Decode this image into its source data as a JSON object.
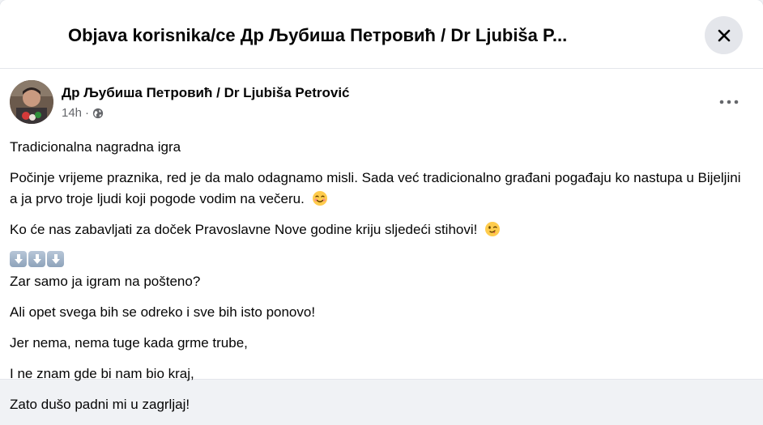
{
  "dialog": {
    "title": "Objava korisnika/ce Др Љубиша Петровић / Dr Ljubiša P...",
    "close_icon": "close-icon"
  },
  "post": {
    "author": "Др Љубиша Петровић / Dr Ljubiša Petrović",
    "time": "14h",
    "separator": "·",
    "audience_icon": "globe-icon",
    "more_icon": "more-horizontal-icon",
    "paragraphs": {
      "p1": "Tradicionalna nagradna igra",
      "p2": "Počinje vrijeme praznika, red je da malo odagnamo misli. Sada već tradicionalno građani pogađaju ko nastupa u Bijeljini a ja prvo troje ljudi koji pogode vodim na večeru.",
      "p3": "Ko će nas zabavljati za doček Pravoslavne Nove godine kriju sljedeći stihovi!"
    },
    "emojis": {
      "p2": "smiling-face-emoji",
      "p3": "winking-face-emoji",
      "arrows": "down-arrow-emoji"
    },
    "poem": [
      "Zar samo ja igram na pošteno?",
      "Ali opet svega bih se odreko i sve bih isto ponovo!",
      "Jer nema, nema tuge kada grme trube,",
      "I ne znam gde bi nam bio kraj,",
      "Zato dušo padni mi u zagrljaj!"
    ]
  }
}
